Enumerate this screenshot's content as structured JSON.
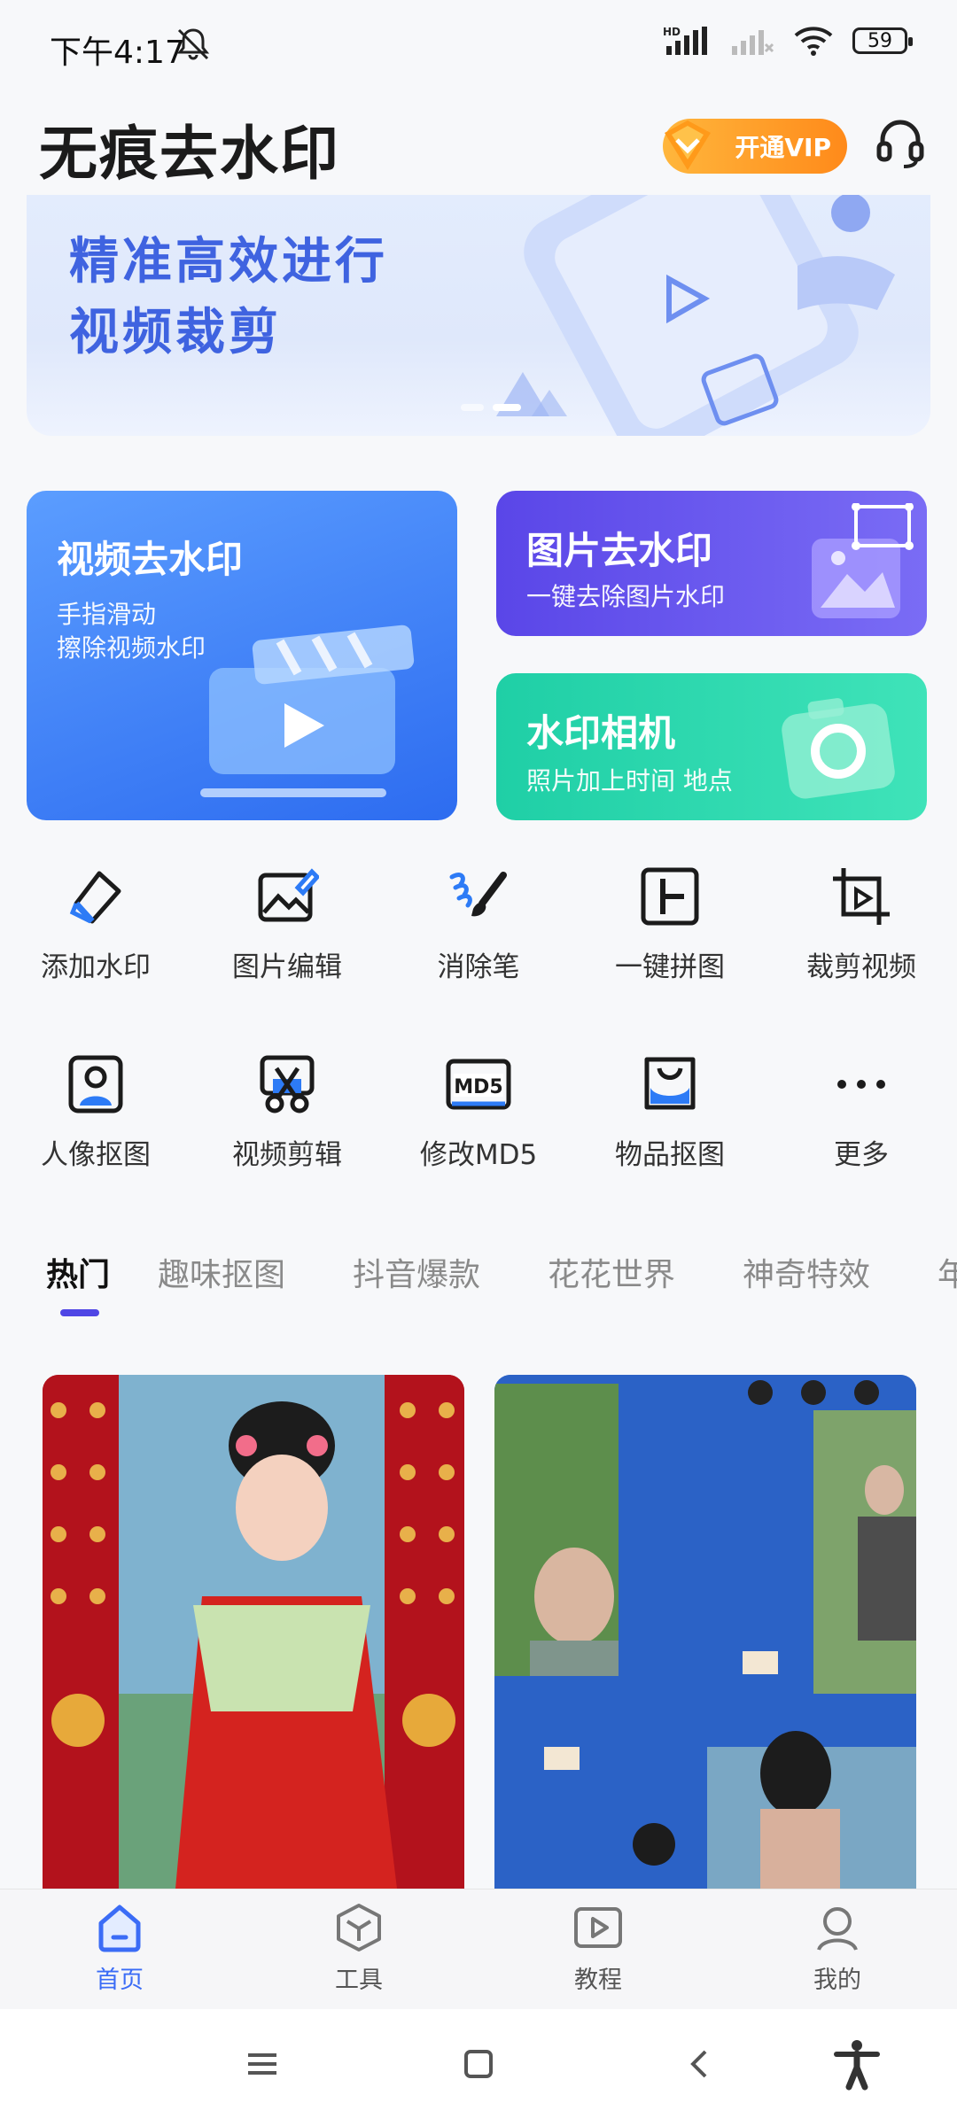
{
  "status_bar": {
    "time": "下午4:17",
    "battery": "59",
    "hd_label": "HD"
  },
  "header": {
    "title": "无痕去水印",
    "vip_label": "开通VIP"
  },
  "banner": {
    "line1": "精准高效进行",
    "line2": "视频裁剪"
  },
  "feature_cards": {
    "video": {
      "title": "视频去水印",
      "sub1": "手指滑动",
      "sub2": "擦除视频水印"
    },
    "image": {
      "title": "图片去水印",
      "sub": "一键去除图片水印"
    },
    "camera": {
      "title": "水印相机",
      "sub": "照片加上时间 地点"
    }
  },
  "tools_row1": [
    {
      "label": "添加水印",
      "icon": "tag-icon"
    },
    {
      "label": "图片编辑",
      "icon": "image-edit-icon"
    },
    {
      "label": "消除笔",
      "icon": "eraser-brush-icon"
    },
    {
      "label": "一键拼图",
      "icon": "collage-icon"
    },
    {
      "label": "裁剪视频",
      "icon": "crop-video-icon"
    }
  ],
  "tools_row2": [
    {
      "label": "人像抠图",
      "icon": "portrait-icon"
    },
    {
      "label": "视频剪辑",
      "icon": "scissors-icon"
    },
    {
      "label": "修改MD5",
      "icon": "md5-icon",
      "badge": "MD5"
    },
    {
      "label": "物品抠图",
      "icon": "bag-icon"
    },
    {
      "label": "更多",
      "icon": "more-icon"
    }
  ],
  "tabs": [
    "热门",
    "趣味抠图",
    "抖音爆款",
    "花花世界",
    "神奇特效",
    "年"
  ],
  "bottom_nav": [
    {
      "label": "首页",
      "icon": "home-icon"
    },
    {
      "label": "工具",
      "icon": "tools-icon"
    },
    {
      "label": "教程",
      "icon": "play-tutorial-icon"
    },
    {
      "label": "我的",
      "icon": "profile-icon"
    }
  ],
  "colors": {
    "accent": "#3b6cf6",
    "tab_indicator": "#4f46e5",
    "vip": "#ff8a1a"
  }
}
